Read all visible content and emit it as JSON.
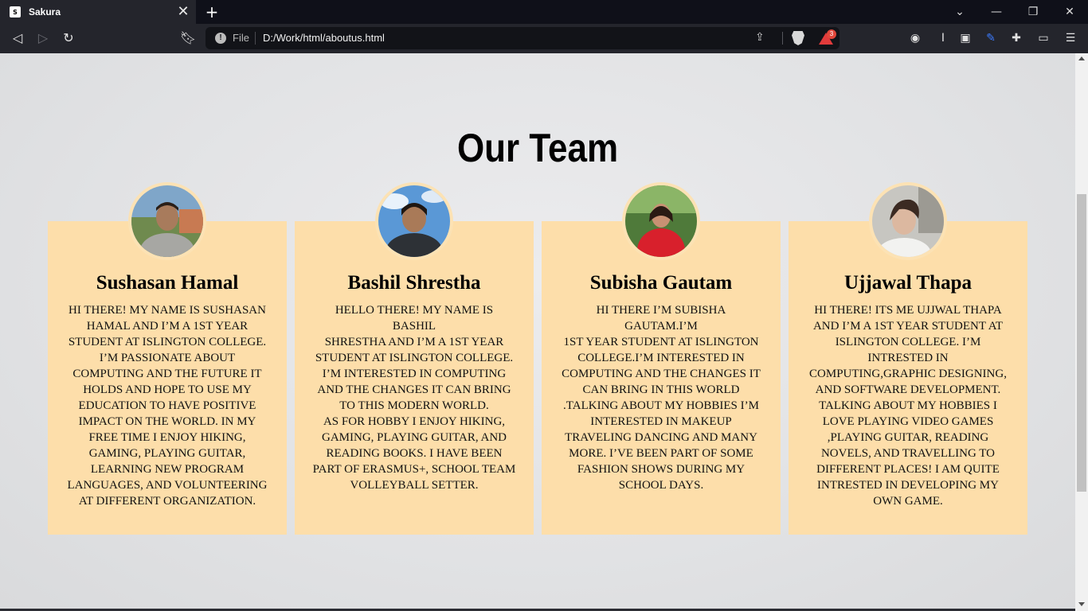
{
  "browser": {
    "tab_title": "Sakura",
    "favicon_text": "S",
    "new_tab": "+",
    "close_tab": "✕",
    "url_scheme": "File",
    "url": "D:/Work/html/aboutus.html",
    "rewards_badge": "3"
  },
  "page": {
    "heading": "Our Team",
    "members": [
      {
        "name": "Sushasan Hamal",
        "bio": "HI THERE! MY NAME IS SUSHASAN\nHAMAL AND I’M A 1ST YEAR\nSTUDENT AT ISLINGTON COLLEGE.\nI’M PASSIONATE ABOUT\nCOMPUTING AND THE FUTURE IT\nHOLDS AND HOPE TO USE MY\nEDUCATION TO HAVE POSITIVE\nIMPACT ON THE WORLD. IN MY\nFREE TIME I ENJOY HIKING,\nGAMING, PLAYING GUITAR,\nLEARNING NEW PROGRAM\nLANGUAGES, AND VOLUNTEERING\nAT DIFFERENT ORGANIZATION."
      },
      {
        "name": "Bashil Shrestha",
        "bio": "HELLO THERE! MY NAME IS BASHIL\nSHRESTHA AND I’M A 1ST YEAR\nSTUDENT AT ISLINGTON COLLEGE.\nI’M INTERESTED IN COMPUTING\nAND THE CHANGES IT CAN BRING\nTO THIS MODERN WORLD.\nAS FOR HOBBY I ENJOY HIKING,\nGAMING, PLAYING GUITAR, AND\nREADING BOOKS. I HAVE BEEN\nPART OF ERASMUS+, SCHOOL TEAM\nVOLLEYBALL SETTER."
      },
      {
        "name": "Subisha Gautam",
        "bio": "HI THERE I’M SUBISHA GAUTAM.I’M\n1ST YEAR STUDENT AT ISLINGTON\nCOLLEGE.I’M INTERESTED IN\nCOMPUTING AND THE CHANGES IT\nCAN BRING IN THIS WORLD\n.TALKING ABOUT MY HOBBIES I’M\nINTERESTED IN MAKEUP\nTRAVELING DANCING AND MANY\nMORE. I’VE BEEN PART OF SOME\nFASHION SHOWS DURING MY\nSCHOOL DAYS."
      },
      {
        "name": "Ujjawal Thapa",
        "bio": "HI THERE! ITS ME UJJWAL THAPA\nAND I’M A 1ST YEAR STUDENT AT\nISLINGTON COLLEGE. I’M\nINTRESTED IN\nCOMPUTING,GRAPHIC DESIGNING,\nAND SOFTWARE DEVELOPMENT.\nTALKING ABOUT MY HOBBIES I\nLOVE PLAYING VIDEO GAMES\n,PLAYING GUITAR, READING\nNOVELS, AND TRAVELLING TO\nDIFFERENT PLACES! I AM QUITE\nINTRESTED IN DEVELOPING MY\nOWN GAME."
      }
    ]
  },
  "colors": {
    "card_bg": "#fddeaa",
    "tabbar_bg": "#0f1019",
    "toolbar_bg": "#24252c"
  }
}
